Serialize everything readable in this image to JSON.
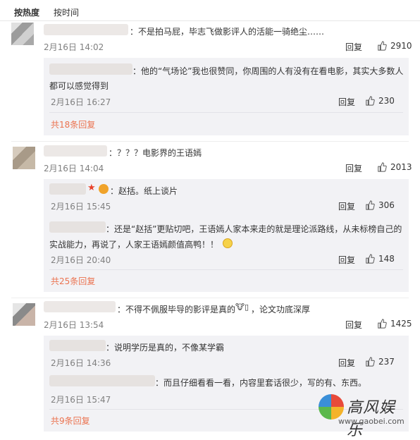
{
  "tabs": {
    "hot": "按热度",
    "time": "按时间"
  },
  "reply_label": "回复",
  "comments": [
    {
      "text": "：不是拍马屁，毕志飞做影评人的活能一骑绝尘……",
      "date": "2月16日 14:02",
      "likes": "2910",
      "subs": [
        {
          "text1": "：他的“气场论”我也很赞同，你周围的人有没有在看电影，其实大多数人",
          "text2": "都可以感觉得到",
          "date": "2月16日 16:27",
          "likes": "230"
        }
      ],
      "more": "共18条回复"
    },
    {
      "text": "：？？？电影界的王语嫣",
      "date": "2月16日 14:04",
      "likes": "2013",
      "subs": [
        {
          "text1": "：赵括。纸上谈片",
          "date": "2月16日 15:45",
          "likes": "306"
        },
        {
          "text1": "：还是“赵括”更贴切吧，王语嫣人家本来走的就是理论派路线，从未标榜自己的",
          "text2": "实战能力，再说了，人家王语嫣颜值高鸭！！",
          "date": "2月16日 20:40",
          "likes": "148"
        }
      ],
      "more": "共25条回复"
    },
    {
      "text": "：不得不佩服毕导的影评是真的",
      "text_tail": "，论文功底深厚",
      "date": "2月16日 13:54",
      "likes": "1425",
      "subs": [
        {
          "text1": "：说明学历是真的，不像某学霸",
          "date": "2月16日 14:36",
          "likes": "237"
        },
        {
          "text1": "：而且仔细看看一看，内容里套话很少，写的有、东西。",
          "date": "2月16日 15:47",
          "likes": ""
        }
      ],
      "more": "共9条回复"
    }
  ],
  "watermark": {
    "brand": "高风娱乐",
    "url": "www.gaobei.com"
  },
  "colors": {
    "more_link": "#eb7350",
    "sub_bg": "#f2f2f5"
  },
  "icons": {
    "like": "thumbs-up-icon",
    "badge": "star-badge-icon"
  }
}
